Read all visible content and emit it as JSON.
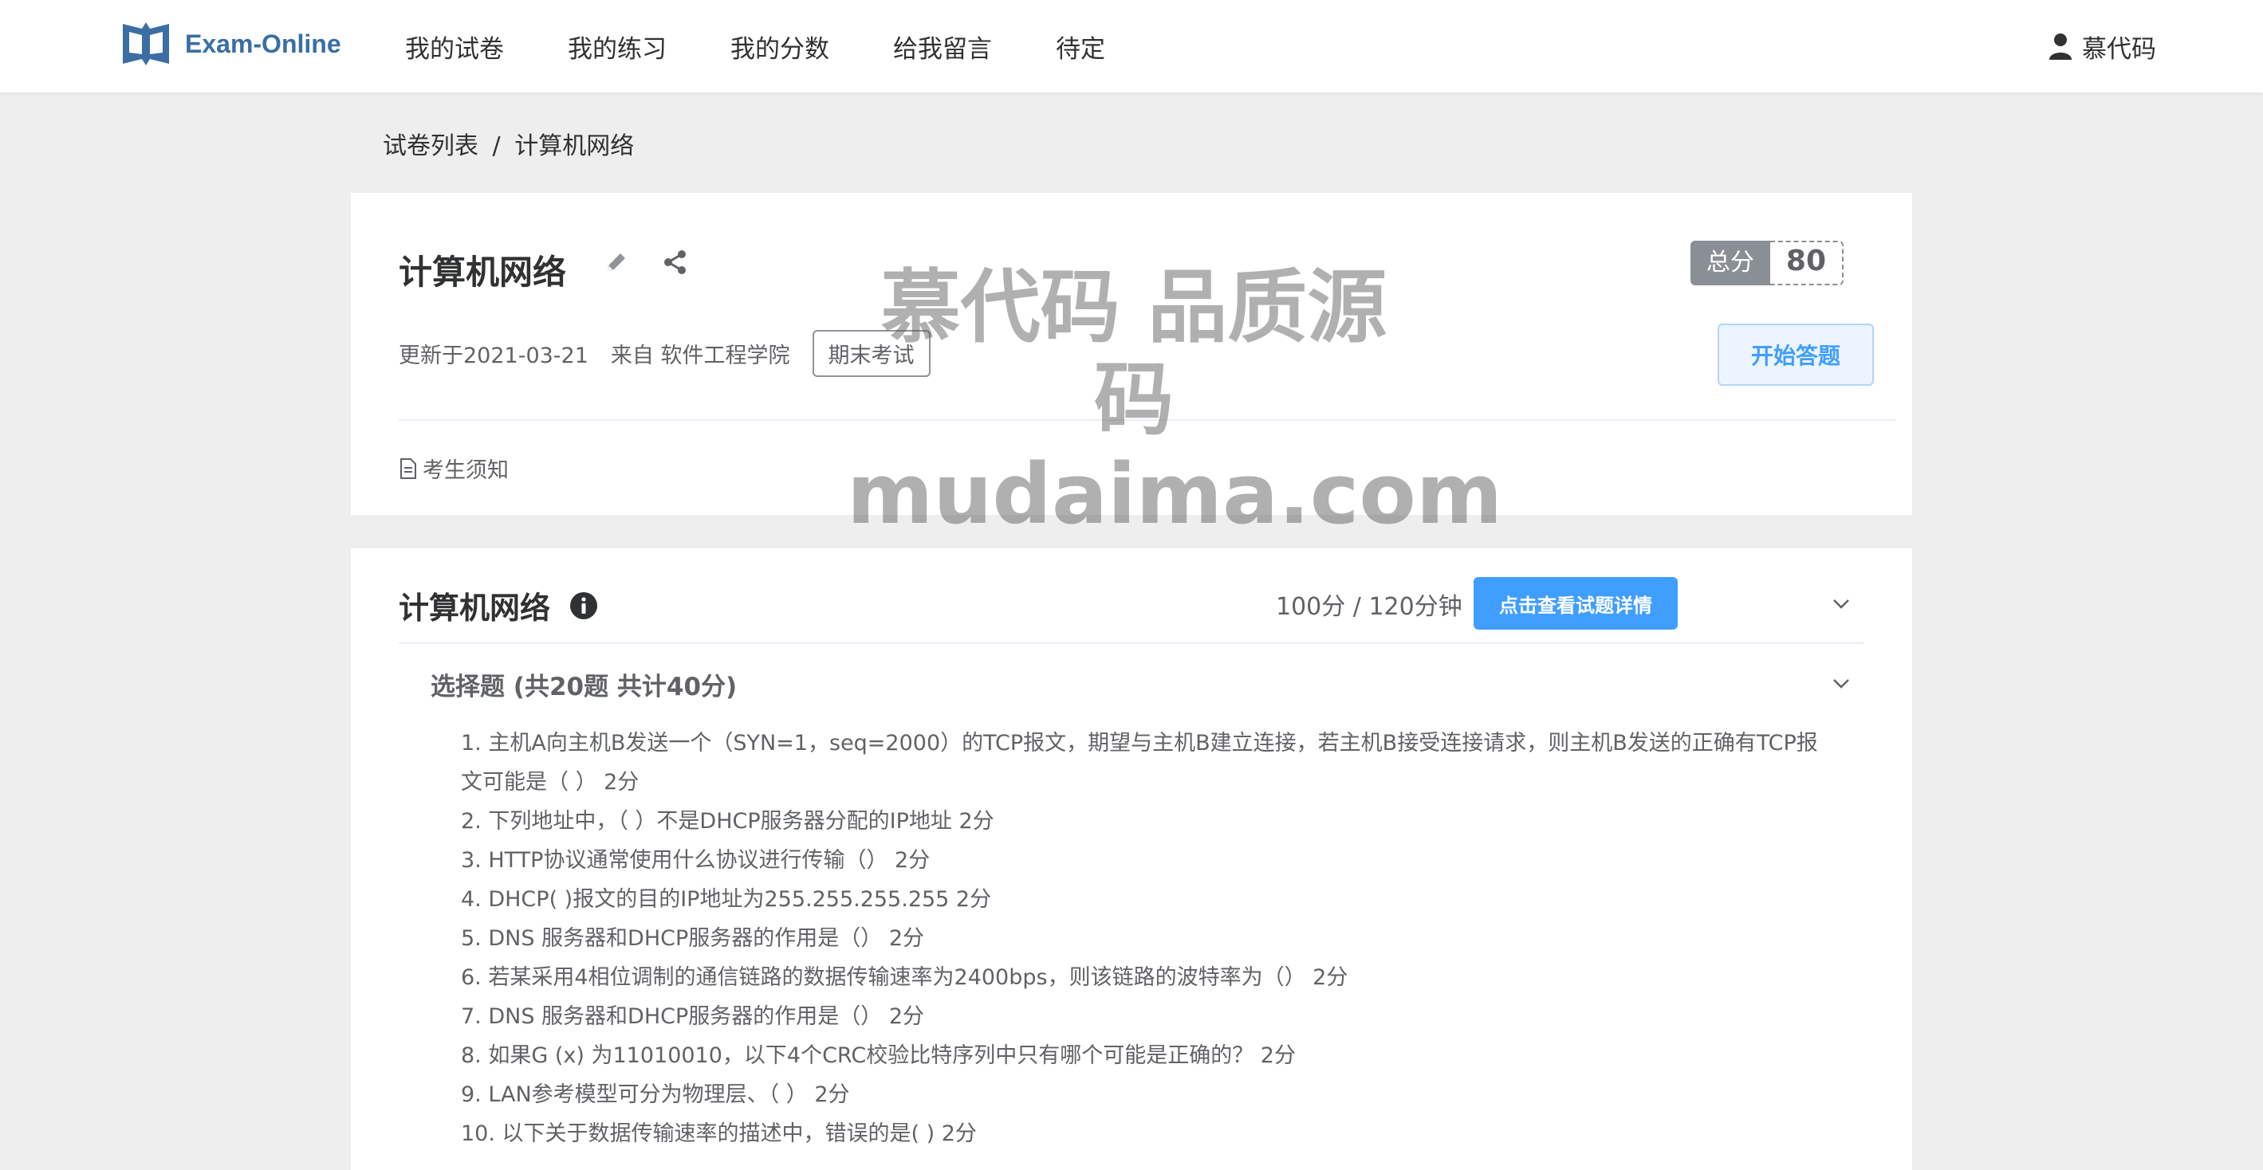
{
  "app": {
    "name": "Exam-Online"
  },
  "nav": {
    "items": [
      "我的试卷",
      "我的练习",
      "我的分数",
      "给我留言",
      "待定"
    ],
    "user": "慕代码"
  },
  "breadcrumb": {
    "parent": "试卷列表",
    "separator": "/",
    "current": "计算机网络"
  },
  "paper": {
    "title": "计算机网络",
    "updated": "更新于2021-03-21",
    "source": "来自 软件工程学院",
    "tag": "期末考试",
    "score_label": "总分",
    "score_value": "80",
    "start_button": "开始答题",
    "notice": "考生须知"
  },
  "section": {
    "title": "计算机网络",
    "meta": "100分 / 120分钟",
    "detail_button": "点击查看试题详情",
    "group_title": "选择题 (共20题 共计40分)",
    "questions": [
      "1. 主机A向主机B发送一个（SYN=1，seq=2000）的TCP报文，期望与主机B建立连接，若主机B接受连接请求，则主机B发送的正确有TCP报文可能是（ ） 2分",
      "2. 下列地址中，（ ）不是DHCP服务器分配的IP地址 2分",
      "3. HTTP协议通常使用什么协议进行传输（） 2分",
      "4. DHCP( )报文的目的IP地址为255.255.255.255 2分",
      "5. DNS 服务器和DHCP服务器的作用是（） 2分",
      "6. 若某采用4相位调制的通信链路的数据传输速率为2400bps，则该链路的波特率为（） 2分",
      "7. DNS 服务器和DHCP服务器的作用是（） 2分",
      "8. 如果G (x) 为11010010，以下4个CRC校验比特序列中只有哪个可能是正确的？ 2分",
      "9. LAN参考模型可分为物理层、（ ） 2分",
      "10. 以下关于数据传输速率的描述中，错误的是( ) 2分"
    ]
  },
  "watermark": {
    "line1": "慕代码 品质源码",
    "line2": "mudaima.com"
  },
  "icons": [
    "logo-book-icon",
    "user-icon",
    "edit-icon",
    "share-icon",
    "document-icon",
    "info-icon",
    "chevron-down-icon"
  ],
  "colors": {
    "primary": "#409eff",
    "logo": "#3a6ea5",
    "score_label_bg": "#8a8f96"
  }
}
